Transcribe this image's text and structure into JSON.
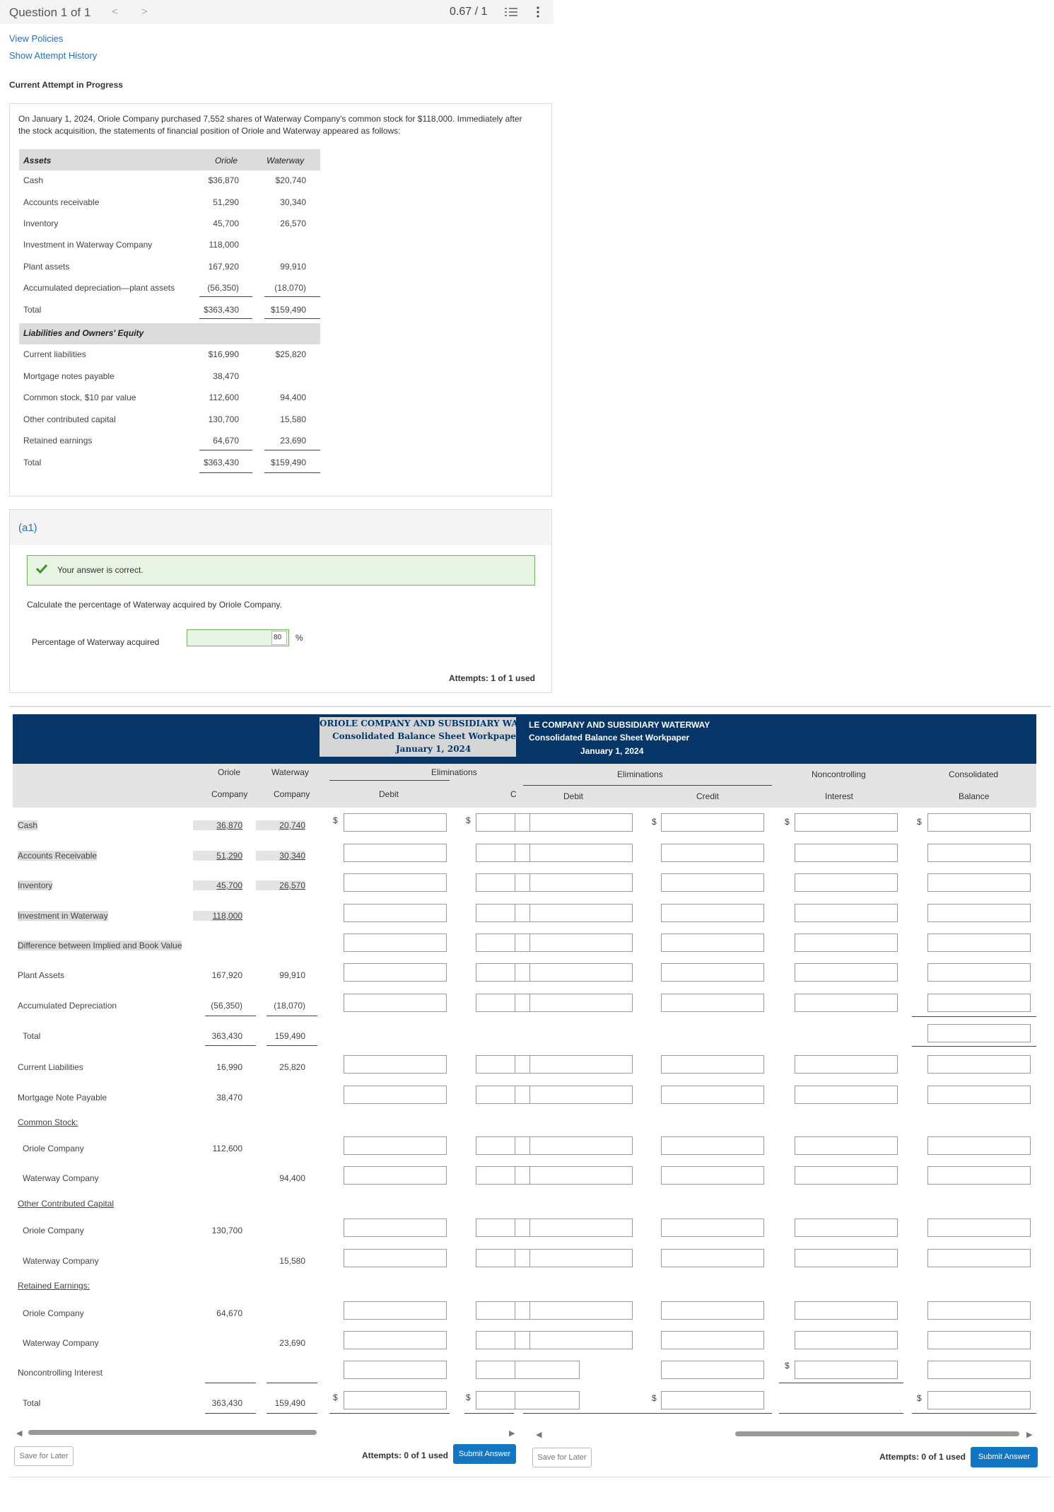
{
  "header": {
    "question_label": "Question 1 of 1",
    "prev": "<",
    "next": ">",
    "score": "0.67 / 1",
    "list_icon": "list-icon",
    "more_icon": "more-icon"
  },
  "links": {
    "view_policies": "View Policies",
    "attempt_history": "Show Attempt History"
  },
  "attempt_status": "Current Attempt in Progress",
  "problem": {
    "text": "On January 1, 2024, Oriole Company purchased 7,552 shares of Waterway Company's common stock for $118,000. Immediately after the stock acquisition, the statements of financial position of Oriole and Waterway appeared as follows:",
    "col_assets": "Assets",
    "col_oriole": "Oriole",
    "col_waterway": "Waterway",
    "assets": [
      {
        "label": "Cash",
        "oriole": "$36,870",
        "waterway": "$20,740"
      },
      {
        "label": "Accounts receivable",
        "oriole": "51,290",
        "waterway": "30,340"
      },
      {
        "label": "Inventory",
        "oriole": "45,700",
        "waterway": "26,570"
      },
      {
        "label": "Investment in Waterway Company",
        "oriole": "118,000",
        "waterway": ""
      },
      {
        "label": "Plant assets",
        "oriole": "167,920",
        "waterway": "99,910"
      },
      {
        "label": "Accumulated depreciation—plant assets",
        "oriole": "(56,350)",
        "waterway": "(18,070)"
      },
      {
        "label": "Total",
        "oriole": "$363,430",
        "waterway": "$159,490"
      }
    ],
    "liab_header": "Liabilities and Owners' Equity",
    "liabilities": [
      {
        "label": "Current liabilities",
        "oriole": "$16,990",
        "waterway": "$25,820"
      },
      {
        "label": "Mortgage notes payable",
        "oriole": "38,470",
        "waterway": ""
      },
      {
        "label": "Common stock, $10 par value",
        "oriole": "112,600",
        "waterway": "94,400"
      },
      {
        "label": "Other contributed capital",
        "oriole": "130,700",
        "waterway": "15,580"
      },
      {
        "label": "Retained earnings",
        "oriole": "64,670",
        "waterway": "23,690"
      },
      {
        "label": "Total",
        "oriole": "$363,430",
        "waterway": "$159,490"
      }
    ]
  },
  "part_a1": {
    "label": "(a1)",
    "correct_msg": "Your answer is correct.",
    "instruction": "Calculate the percentage of Waterway acquired by Oriole Company.",
    "field_label": "Percentage of Waterway acquired",
    "value": "80",
    "unit": "%",
    "attempts": "Attempts: 1 of 1 used"
  },
  "workpaper": {
    "title1": "ORIOLE COMPANY AND SUBSIDIARY WATE",
    "title2": "Consolidated Balance Sheet Workpape",
    "title3": "January 1, 2024",
    "title1b": "LE COMPANY AND SUBSIDIARY WATERWAY",
    "title2b": "Consolidated Balance Sheet Workpaper",
    "title3b": "January 1, 2024",
    "col_oriole1": "Oriole",
    "col_oriole2": "Company",
    "col_water1": "Waterway",
    "col_water2": "Company",
    "eliminations": "Eliminations",
    "debit": "Debit",
    "credit": "Credit",
    "credit_clip": "C",
    "nci1": "Noncontrolling",
    "nci2": "Interest",
    "cons1": "Consolidated",
    "cons2": "Balance",
    "dollar": "$",
    "rows": [
      {
        "label": "Cash",
        "oriole": "36,870",
        "waterway": "20,740"
      },
      {
        "label": "Accounts Receivable",
        "oriole": "51,290",
        "waterway": "30,340"
      },
      {
        "label": "Inventory",
        "oriole": "45,700",
        "waterway": "26,570"
      },
      {
        "label": "Investment in Waterway",
        "oriole": "118,000",
        "waterway": ""
      },
      {
        "label": "Difference between Implied and Book Value",
        "oriole": "",
        "waterway": ""
      },
      {
        "label": "Plant Assets",
        "oriole": "167,920",
        "waterway": "99,910"
      },
      {
        "label": "Accumulated Depreciation",
        "oriole": "(56,350)",
        "waterway": "(18,070)"
      },
      {
        "label": "Total",
        "oriole": "363,430",
        "waterway": "159,490"
      },
      {
        "label": "Current Liabilities",
        "oriole": "16,990",
        "waterway": "25,820"
      },
      {
        "label": "Mortgage Note Payable",
        "oriole": "38,470",
        "waterway": ""
      },
      {
        "label": "Common Stock:",
        "oriole": "",
        "waterway": ""
      },
      {
        "label": "Oriole Company",
        "oriole": "112,600",
        "waterway": ""
      },
      {
        "label": "Waterway Company",
        "oriole": "",
        "waterway": "94,400"
      },
      {
        "label": "Other Contributed Capital",
        "oriole": "",
        "waterway": ""
      },
      {
        "label": "Oriole Company",
        "oriole": "130,700",
        "waterway": ""
      },
      {
        "label": "Waterway Company",
        "oriole": "",
        "waterway": "15,580"
      },
      {
        "label": "Retained Earnings:",
        "oriole": "",
        "waterway": ""
      },
      {
        "label": "Oriole Company",
        "oriole": "64,670",
        "waterway": ""
      },
      {
        "label": "Waterway Company",
        "oriole": "",
        "waterway": "23,690"
      },
      {
        "label": "Noncontrolling Interest",
        "oriole": "",
        "waterway": ""
      },
      {
        "label": "Total",
        "oriole": "363,430",
        "waterway": "159,490"
      }
    ],
    "save_label": "Save for Later",
    "attempts": "Attempts: 0 of 1 used",
    "submit_label": "Submit Answer"
  }
}
